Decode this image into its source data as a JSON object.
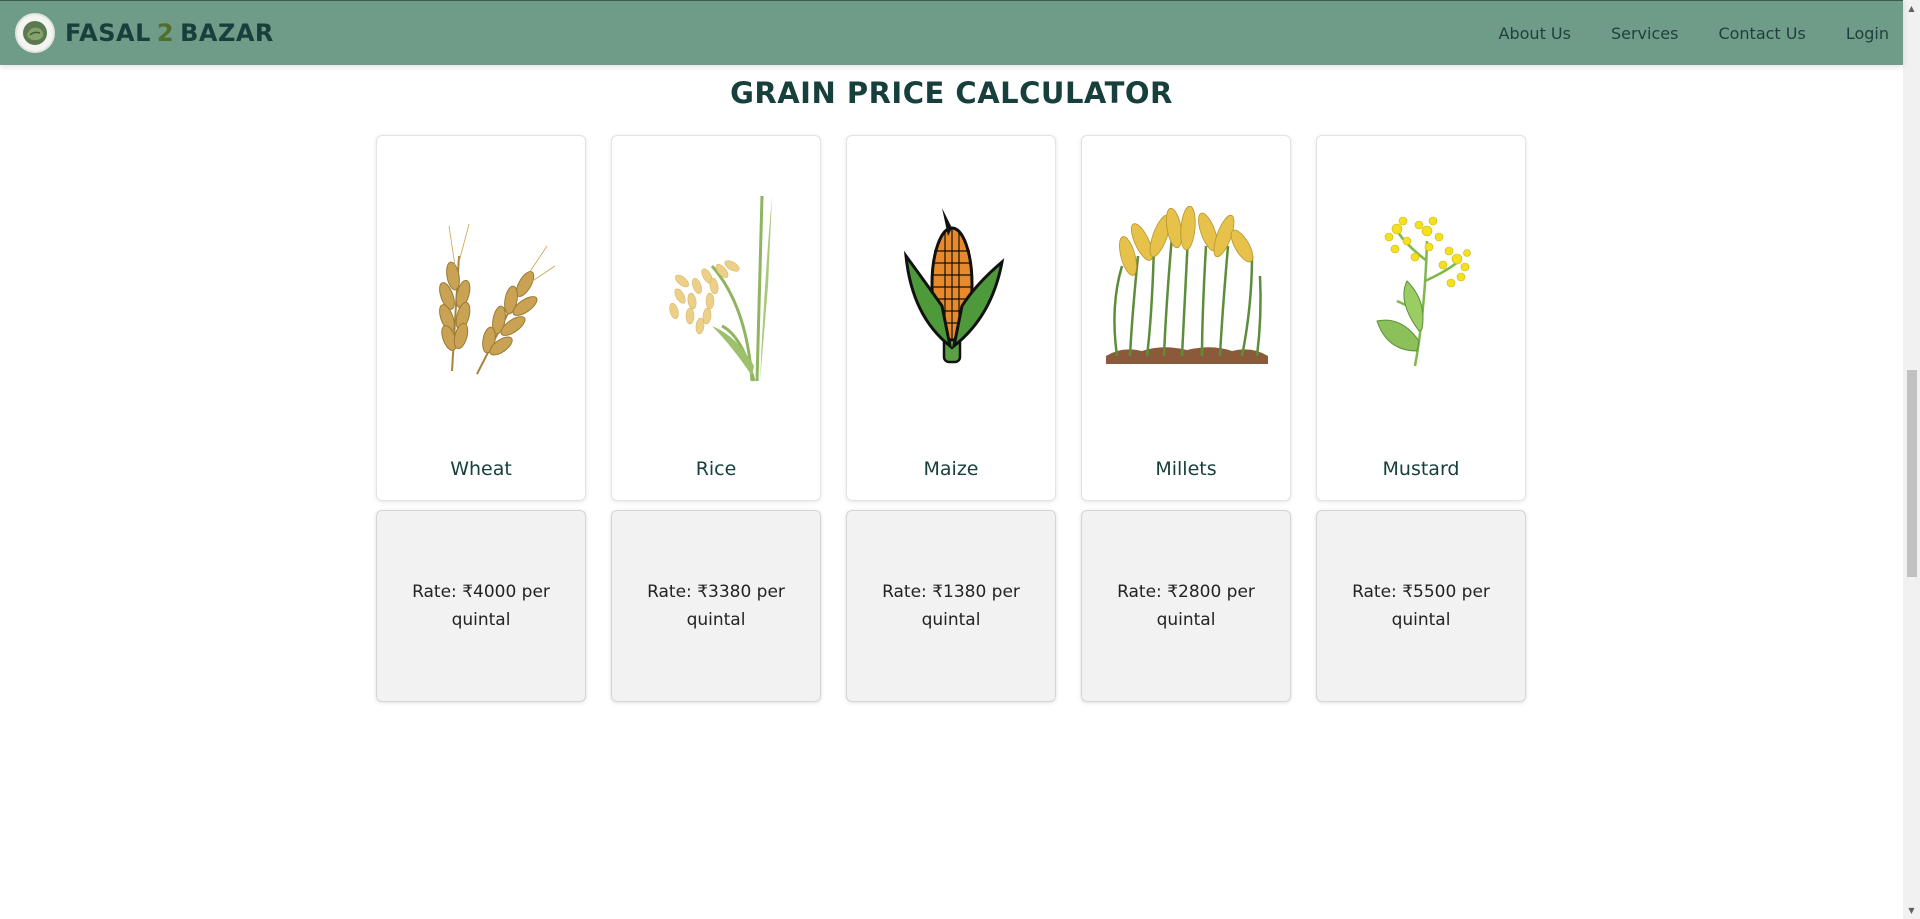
{
  "nav": {
    "brand_part1": "FASAL",
    "brand_part2": "2",
    "brand_part3": "BAZAR",
    "links": [
      "About Us",
      "Services",
      "Contact Us",
      "Login"
    ]
  },
  "title": "GRAIN PRICE CALCULATOR",
  "grains": [
    {
      "name": "Wheat",
      "rate": "Rate: ₹4000 per quintal"
    },
    {
      "name": "Rice",
      "rate": "Rate: ₹3380 per quintal"
    },
    {
      "name": "Maize",
      "rate": "Rate: ₹1380 per quintal"
    },
    {
      "name": "Millets",
      "rate": "Rate: ₹2800 per quintal"
    },
    {
      "name": "Mustard",
      "rate": "Rate: ₹5500 per quintal"
    }
  ],
  "colors": {
    "navbar": "#6e9c88",
    "brand": "#17403c",
    "rate_bg": "#f2f2f2"
  }
}
